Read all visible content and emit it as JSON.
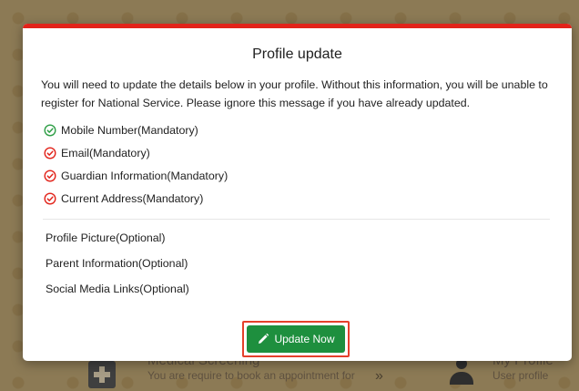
{
  "background": {
    "card_left_title": "Medical Screening",
    "card_left_sub": "You are require to book an appointment for",
    "card_right_title": "My Profile",
    "card_right_sub": "User profile",
    "chevron": "»"
  },
  "modal": {
    "title": "Profile update",
    "message": "You will need to update the details below in your profile. Without this information, you will be unable to register for National Service. Please ignore this message if you have already updated.",
    "mandatory_items": [
      {
        "label": "Mobile Number(Mandatory)",
        "status": "complete",
        "color": "#2e9e46"
      },
      {
        "label": "Email(Mandatory)",
        "status": "incomplete",
        "color": "#e2231a"
      },
      {
        "label": "Guardian Information(Mandatory)",
        "status": "incomplete",
        "color": "#e2231a"
      },
      {
        "label": "Current Address(Mandatory)",
        "status": "incomplete",
        "color": "#e2231a"
      }
    ],
    "optional_items": [
      {
        "label": "Profile Picture(Optional)"
      },
      {
        "label": "Parent Information(Optional)"
      },
      {
        "label": "Social Media Links(Optional)"
      }
    ],
    "update_button": {
      "label": "Update Now",
      "icon": "pencil-icon",
      "color": "#1e8f3e"
    },
    "accent_color": "#e2231a"
  }
}
